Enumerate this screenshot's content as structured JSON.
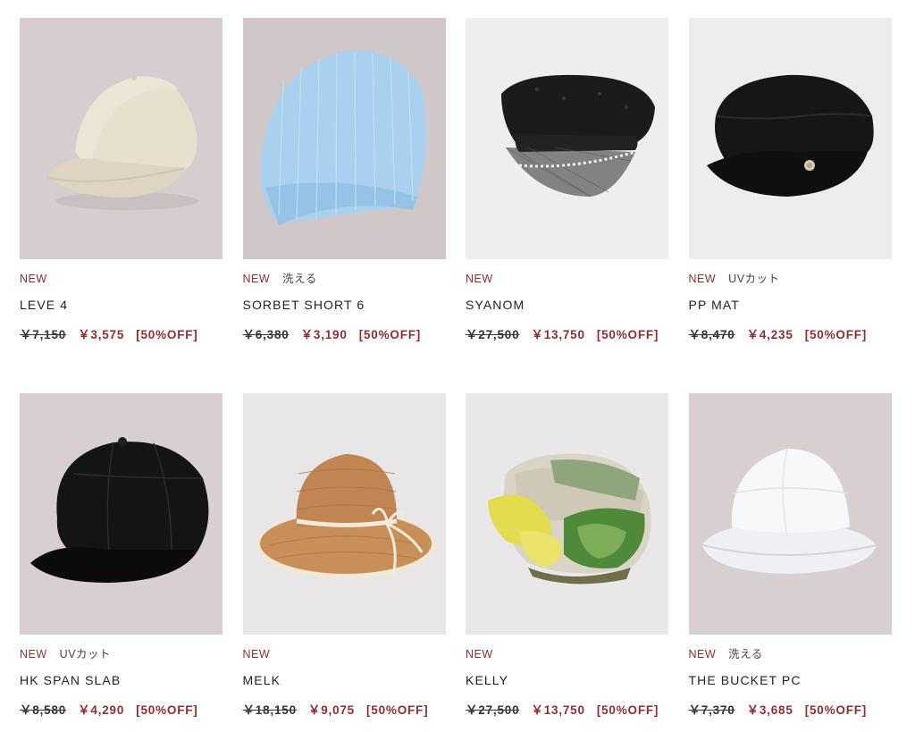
{
  "products": [
    {
      "tags": [
        "NEW"
      ],
      "name": "LEVE 4",
      "price_original": "￥7,150",
      "price_sale": "￥3,575",
      "discount": "[50%OFF]",
      "image": "beige-baseball-cap",
      "bg": "#d5cdcd"
    },
    {
      "tags": [
        "NEW",
        "洗える"
      ],
      "name": "SORBET SHORT 6",
      "price_original": "￥6,380",
      "price_sale": "￥3,190",
      "discount": "[50%OFF]",
      "image": "light-blue-knit-beanie",
      "bg": "#cfc7c7"
    },
    {
      "tags": [
        "NEW"
      ],
      "name": "SYANOM",
      "price_original": "￥27,500",
      "price_sale": "￥13,750",
      "discount": "[50%OFF]",
      "image": "black-tweed-marine-cap-with-veil",
      "bg": "#efeded"
    },
    {
      "tags": [
        "NEW",
        "UVカット"
      ],
      "name": "PP MAT",
      "price_original": "￥8,470",
      "price_sale": "￥4,235",
      "discount": "[50%OFF]",
      "image": "black-marine-cap",
      "bg": "#eeecec"
    },
    {
      "tags": [
        "NEW",
        "UVカット"
      ],
      "name": "HK SPAN SLAB",
      "price_original": "￥8,580",
      "price_sale": "￥4,290",
      "discount": "[50%OFF]",
      "image": "black-casquette",
      "bg": "#d8d0d0"
    },
    {
      "tags": [
        "NEW"
      ],
      "name": "MELK",
      "price_original": "￥18,150",
      "price_sale": "￥9,075",
      "discount": "[50%OFF]",
      "image": "straw-hat-with-ribbon",
      "bg": "#e8e6e6"
    },
    {
      "tags": [
        "NEW"
      ],
      "name": "KELLY",
      "price_original": "￥27,500",
      "price_sale": "￥13,750",
      "discount": "[50%OFF]",
      "image": "scarf-turban",
      "bg": "#e9e7e7"
    },
    {
      "tags": [
        "NEW",
        "洗える"
      ],
      "name": "THE BUCKET PC",
      "price_original": "￥7,370",
      "price_sale": "￥3,685",
      "discount": "[50%OFF]",
      "image": "white-bucket-hat",
      "bg": "#d8d0d0"
    }
  ],
  "colors": {
    "accent": "#8a2f33",
    "text": "#222222"
  }
}
